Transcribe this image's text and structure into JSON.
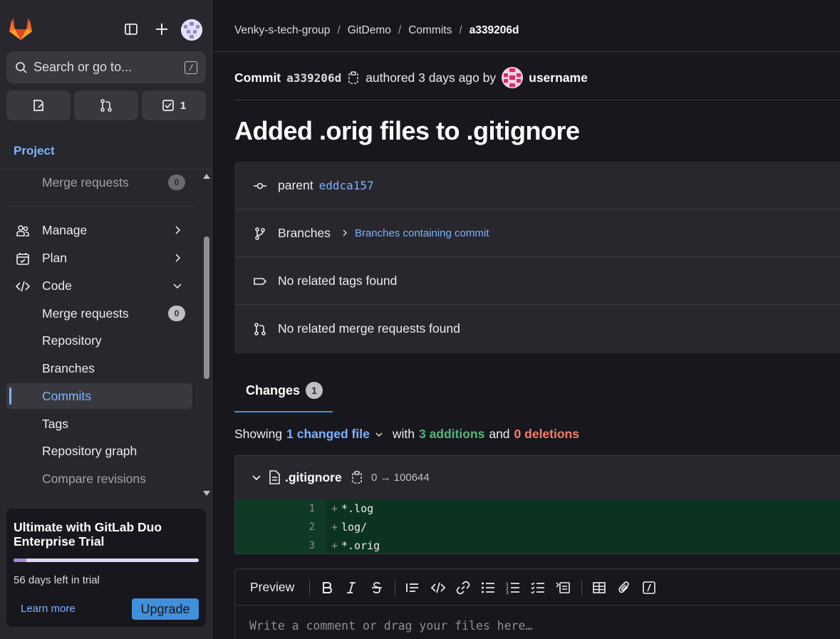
{
  "sidebar": {
    "search_placeholder": "Search or go to...",
    "search_shortcut": "/",
    "quick_todos_count": "1",
    "project_label": "Project",
    "items": [
      {
        "label": "Merge requests",
        "badge": "0"
      },
      {
        "label": "Manage"
      },
      {
        "label": "Plan"
      },
      {
        "label": "Code"
      },
      {
        "label": "Merge requests",
        "badge": "0"
      },
      {
        "label": "Repository"
      },
      {
        "label": "Branches"
      },
      {
        "label": "Commits"
      },
      {
        "label": "Tags"
      },
      {
        "label": "Repository graph"
      },
      {
        "label": "Compare revisions"
      }
    ],
    "trial": {
      "title": "Ultimate with GitLab Duo Enterprise Trial",
      "days_left": "56 days left in trial",
      "progress_fraction": 0.07,
      "learn_more": "Learn more",
      "upgrade": "Upgrade"
    }
  },
  "breadcrumb": [
    "Venky-s-tech-group",
    "GitDemo",
    "Commits",
    "a339206d"
  ],
  "commit": {
    "label": "Commit",
    "sha": "a339206d",
    "authored": "authored 3 days ago by",
    "author": "username",
    "title": "Added .orig files to .gitignore",
    "parent_label": "parent",
    "parent_sha": "eddca157",
    "branches_label": "Branches",
    "branches_link": "Branches containing commit",
    "tags_text": "No related tags found",
    "mr_text": "No related merge requests found"
  },
  "changes": {
    "tab_label": "Changes",
    "tab_count": "1",
    "showing": "Showing",
    "changed_file": "1 changed file",
    "with": "with",
    "additions": "3 additions",
    "and": "and",
    "deletions": "0 deletions"
  },
  "file": {
    "name": ".gitignore",
    "mode": "0 → 100644",
    "lines": [
      {
        "num": "1",
        "sign": "+",
        "code": "*.log"
      },
      {
        "num": "2",
        "sign": "+",
        "code": "log/"
      },
      {
        "num": "3",
        "sign": "+",
        "code": "*.orig"
      }
    ]
  },
  "editor": {
    "preview_label": "Preview",
    "placeholder": "Write a comment or drag your files here…"
  },
  "colors": {
    "accent": "#428fdc",
    "link": "#7cb3ff",
    "additions": "#52b87a",
    "deletions": "#f57f6c"
  }
}
